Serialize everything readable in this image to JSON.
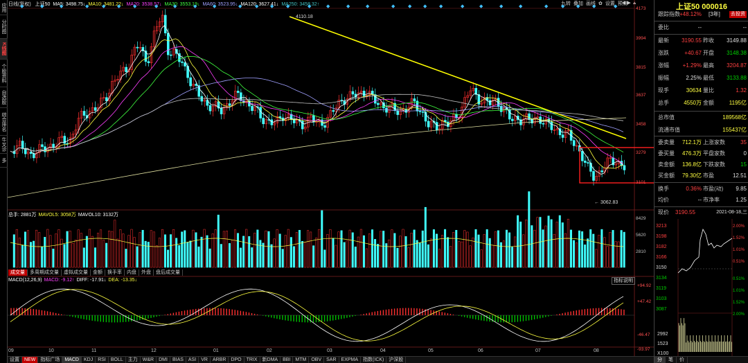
{
  "left_tabs": [
    "应用",
    "分时图",
    "K线图",
    "个股资料",
    "自选股",
    "综合排名",
    "牛叉诊股",
    "多"
  ],
  "left_tab_active": 2,
  "top": {
    "period": "日线(复权)",
    "items": [
      {
        "text": "上证50",
        "color": "#ffffff"
      },
      {
        "text": "MA5: 3498.75↓",
        "color": "#ffffff"
      },
      {
        "text": "MA10: 3481.22↓",
        "color": "#ffff40"
      },
      {
        "text": "MA20: 3538.57↓",
        "color": "#ff40ff"
      },
      {
        "text": "MA30: 3553.19↓",
        "color": "#40ff40"
      },
      {
        "text": "MA60: 3523.95↓",
        "color": "#a0a0ff"
      },
      {
        "text": "MA120: 3627.41↓",
        "color": "#ffffff"
      },
      {
        "text": "MA250: 3458.32↑",
        "color": "#40c0c0"
      }
    ]
  },
  "toolbar": [
    "九转",
    "叠加",
    "画线",
    "✿",
    "设置",
    "预测"
  ],
  "price_axis": [
    "4173",
    "3994",
    "3815",
    "3637",
    "3458",
    "3279",
    "3101"
  ],
  "volume_axis": [
    "8429",
    "5620",
    "2810"
  ],
  "macd_axis": [
    "+94.92",
    "+47.42",
    "-46.47",
    "-93.97"
  ],
  "months": [
    "09",
    "10",
    "11",
    "12",
    "01",
    "02",
    "03",
    "04",
    "05",
    "06",
    "07",
    "08"
  ],
  "high_label": "← 4110.18",
  "low_label": "← 3062.83",
  "volume_info": [
    {
      "text": "总手: 2881万",
      "color": "#ffffff"
    },
    {
      "text": "MAVOL5: 3058万",
      "color": "#ffff40"
    },
    {
      "text": "MAVOL10: 3132万",
      "color": "#ffffff"
    }
  ],
  "volume_tabs": [
    "成交量",
    "多周期成交量",
    "虚拟成交量",
    "金额",
    "换手率",
    "内盘",
    "外盘",
    "盘后成交量"
  ],
  "macd_info": [
    {
      "text": "MACD(12,26,9)",
      "color": "#ffffff"
    },
    {
      "text": "MACD: -9.12↑",
      "color": "#ff40ff"
    },
    {
      "text": "DIFF: -17.91↓",
      "color": "#ffffff"
    },
    {
      "text": "DEA: -13.35↓",
      "color": "#ffff40"
    }
  ],
  "macd_button": "指标说明",
  "bottom_tabs": [
    "设置",
    "NEW",
    "指标广场",
    "MACD",
    "KDJ",
    "RSI",
    "BOLL",
    "主力",
    "W&R",
    "DMI",
    "BIAS",
    "ASI",
    "VR",
    "ARBR",
    "DPO",
    "TRIX",
    "新DMA",
    "BBI",
    "MTM",
    "OBV",
    "SAR",
    "EXPMA",
    "指数(ICK)",
    "沪深股"
  ],
  "bottom_tab_active": "MACD",
  "panel": {
    "title": "上证50 000016",
    "track_label": "跟踪指数",
    "track_value": "+48.12%",
    "track_period": "[3年]",
    "buy_button": "去投资",
    "weibi_label": "委比",
    "weibi_value": "--",
    "weicha_value": "--",
    "rows": [
      {
        "k": "最新",
        "v": "3190.55",
        "vc": "red",
        "k2": "昨收",
        "v2": "3149.88",
        "v2c": "wht"
      },
      {
        "k": "涨跌",
        "v": "+40.67",
        "vc": "red",
        "k2": "开盘",
        "v2": "3148.38",
        "v2c": "grn"
      },
      {
        "k": "涨幅",
        "v": "+1.29%",
        "vc": "red",
        "k2": "最高",
        "v2": "3204.87",
        "v2c": "red"
      },
      {
        "k": "振幅",
        "v": "2.25%",
        "vc": "wht",
        "k2": "最低",
        "v2": "3133.88",
        "v2c": "grn"
      },
      {
        "k": "现手",
        "v": "30634",
        "vc": "yel",
        "k2": "量比",
        "v2": "1.32",
        "v2c": "red"
      },
      {
        "k": "总手",
        "v": "4550万",
        "vc": "yel",
        "k2": "金额",
        "v2": "1195亿",
        "v2c": "yel"
      }
    ],
    "mktcap": [
      {
        "k": "总市值",
        "v": "189568亿"
      },
      {
        "k": "流通市值",
        "v": "155437亿"
      }
    ],
    "volrows": [
      {
        "k": "委卖量",
        "v": "712.1万",
        "k2": "上涨家数",
        "v2": "35",
        "v2c": "red"
      },
      {
        "k": "委买量",
        "v": "476.3万",
        "k2": "平盘家数",
        "v2": "0",
        "v2c": "wht"
      },
      {
        "k": "卖金额",
        "v": "136.8亿",
        "k2": "下跌家数",
        "v2": "15",
        "v2c": "grn"
      },
      {
        "k": "买金额",
        "v": "79.30亿",
        "k2": "市盈",
        "v2": "12.51",
        "v2c": "wht"
      }
    ],
    "extra": [
      {
        "k": "换手",
        "v": "0.36%",
        "vc": "red",
        "k2": "市盈(动)",
        "v2": "9.85"
      },
      {
        "k": "均价",
        "v": "--",
        "vc": "wht",
        "k2": "市净率",
        "v2": "1.25"
      }
    ],
    "now_label": "现价",
    "now_value": "3190.55",
    "now_date": "2021-08-18,三",
    "mini_left": [
      "3213",
      "3198",
      "3182",
      "3166",
      "3150",
      "3134",
      "3119",
      "3103",
      "3087"
    ],
    "mini_right": [
      "2.00%",
      "1.52%",
      "1.01%",
      "0.51%",
      "0.51%",
      "1.01%",
      "1.52%",
      "2.00%"
    ],
    "mini_vol_left": [
      "2992",
      "1523",
      "X100"
    ],
    "bottom_tabs": [
      "分",
      "笔",
      "价"
    ]
  }
}
